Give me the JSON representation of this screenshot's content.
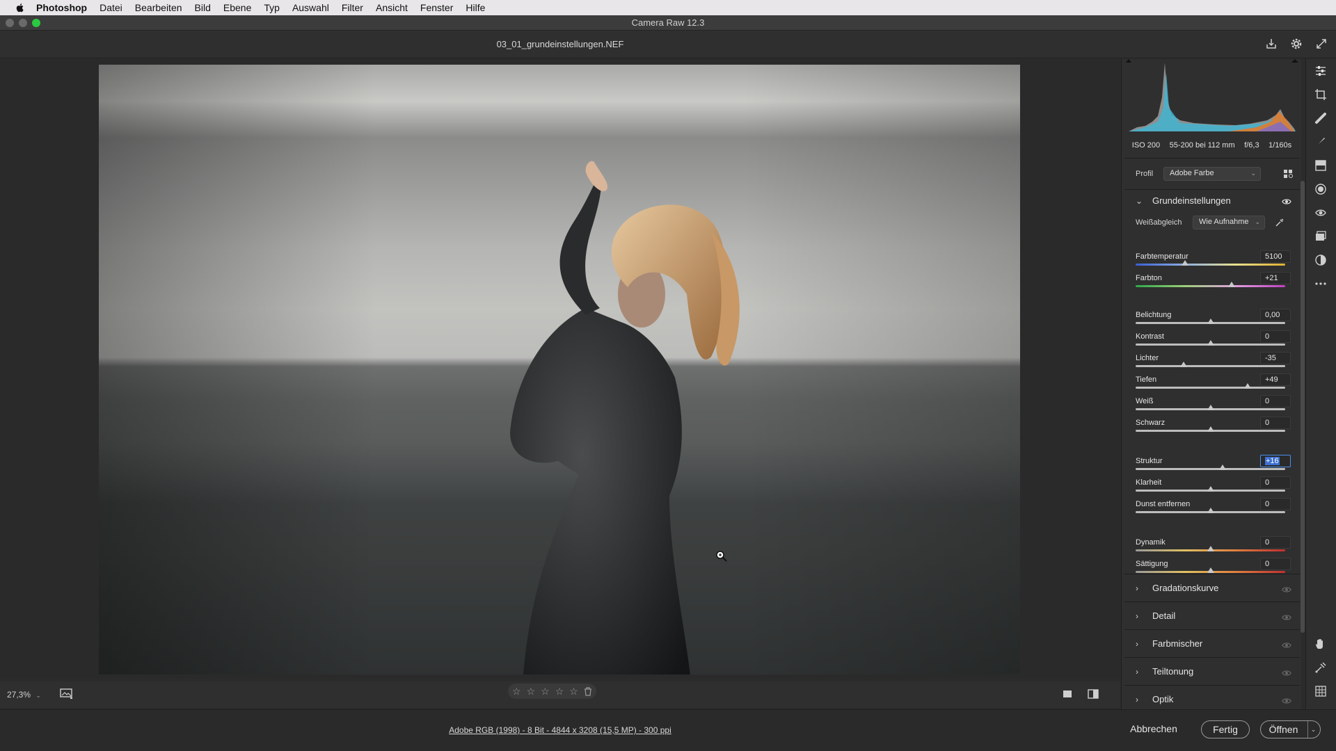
{
  "menubar": {
    "items": [
      "Photoshop",
      "Datei",
      "Bearbeiten",
      "Bild",
      "Ebene",
      "Typ",
      "Auswahl",
      "Filter",
      "Ansicht",
      "Fenster",
      "Hilfe"
    ]
  },
  "window": {
    "title": "Camera Raw 12.3"
  },
  "file": {
    "name": "03_01_grundeinstellungen.NEF"
  },
  "canvas": {
    "zoom": "27,3%",
    "rating_stars": 0,
    "image_info": "Adobe RGB (1998) - 8 Bit - 4844 x 3208 (15,5 MP) - 300 ppi"
  },
  "exif": {
    "iso": "ISO 200",
    "lens": "55-200 bei 112 mm",
    "aperture": "f/6,3",
    "shutter": "1/160s"
  },
  "profile": {
    "label": "Profil",
    "value": "Adobe Farbe"
  },
  "basic": {
    "title": "Grundeinstellungen",
    "wb_label": "Weißabgleich",
    "wb_value": "Wie Aufnahme",
    "sliders": [
      {
        "label": "Farbtemperatur",
        "value": "5100",
        "pos": 0.33
      },
      {
        "label": "Farbton",
        "value": "+21",
        "pos": 0.64
      },
      {
        "label": "Belichtung",
        "value": "0,00",
        "pos": 0.5
      },
      {
        "label": "Kontrast",
        "value": "0",
        "pos": 0.5
      },
      {
        "label": "Lichter",
        "value": "-35",
        "pos": 0.32
      },
      {
        "label": "Tiefen",
        "value": "+49",
        "pos": 0.75
      },
      {
        "label": "Weiß",
        "value": "0",
        "pos": 0.5
      },
      {
        "label": "Schwarz",
        "value": "0",
        "pos": 0.5
      },
      {
        "label": "Struktur",
        "value": "+16",
        "pos": 0.58
      },
      {
        "label": "Klarheit",
        "value": "0",
        "pos": 0.5
      },
      {
        "label": "Dunst entfernen",
        "value": "0",
        "pos": 0.5
      },
      {
        "label": "Dynamik",
        "value": "0",
        "pos": 0.5
      },
      {
        "label": "Sättigung",
        "value": "0",
        "pos": 0.5
      }
    ]
  },
  "sections": [
    "Gradationskurve",
    "Detail",
    "Farbmischer",
    "Teiltonung",
    "Optik"
  ],
  "footer": {
    "cancel": "Abbrechen",
    "done": "Fertig",
    "open": "Öffnen"
  },
  "colors": {
    "accent": "#3b6fd0",
    "panel": "#2f2f2f",
    "background": "#2a2a2a"
  }
}
